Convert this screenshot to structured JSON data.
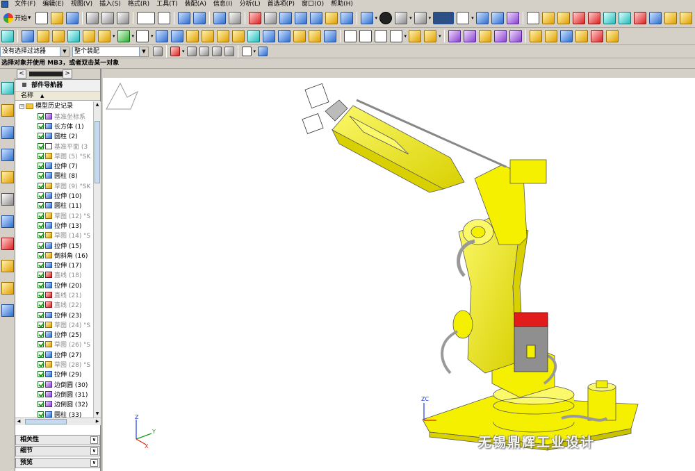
{
  "menu": [
    "文件(F)",
    "编辑(E)",
    "视图(V)",
    "插入(S)",
    "格式(R)",
    "工具(T)",
    "装配(A)",
    "信息(I)",
    "分析(L)",
    "首选项(P)",
    "窗口(O)",
    "帮助(H)"
  ],
  "toolbar": {
    "start_label": "开始"
  },
  "filters": {
    "selection_filter": "没有选择过滤器",
    "scope": "整个装配"
  },
  "cue_line": "选择对象并使用 MB3，或者双击某一对象",
  "navigator": {
    "title": "部件导航器",
    "column_name": "名称",
    "root": "模型历史记录",
    "items": [
      {
        "label": "基准坐标系",
        "type": "csys",
        "dim": true
      },
      {
        "label": "长方体 (1)",
        "type": "block",
        "dim": false
      },
      {
        "label": "圆柱 (2)",
        "type": "cyl",
        "dim": false
      },
      {
        "label": "基准平面 (3",
        "type": "plane",
        "dim": true
      },
      {
        "label": "草图 (5) \"SK",
        "type": "sketch",
        "dim": true
      },
      {
        "label": "拉伸 (7)",
        "type": "extrude",
        "dim": false
      },
      {
        "label": "圆柱 (8)",
        "type": "cyl",
        "dim": false
      },
      {
        "label": "草图 (9) \"SK",
        "type": "sketch",
        "dim": true
      },
      {
        "label": "拉伸 (10)",
        "type": "extrude",
        "dim": false
      },
      {
        "label": "圆柱 (11)",
        "type": "cyl",
        "dim": false
      },
      {
        "label": "草图 (12) \"S",
        "type": "sketch",
        "dim": true
      },
      {
        "label": "拉伸 (13)",
        "type": "extrude",
        "dim": false
      },
      {
        "label": "草图 (14) \"S",
        "type": "sketch",
        "dim": true
      },
      {
        "label": "拉伸 (15)",
        "type": "extrude",
        "dim": false
      },
      {
        "label": "倒斜角 (16)",
        "type": "chamfer",
        "dim": false
      },
      {
        "label": "拉伸 (17)",
        "type": "extrude",
        "dim": false
      },
      {
        "label": "直线 (18)",
        "type": "line",
        "dim": true
      },
      {
        "label": "拉伸 (20)",
        "type": "extrude",
        "dim": false
      },
      {
        "label": "直线 (21)",
        "type": "line",
        "dim": true
      },
      {
        "label": "直线 (22)",
        "type": "line",
        "dim": true
      },
      {
        "label": "拉伸 (23)",
        "type": "extrude",
        "dim": false
      },
      {
        "label": "草图 (24) \"S",
        "type": "sketch",
        "dim": true
      },
      {
        "label": "拉伸 (25)",
        "type": "extrude",
        "dim": false
      },
      {
        "label": "草图 (26) \"S",
        "type": "sketch",
        "dim": true
      },
      {
        "label": "拉伸 (27)",
        "type": "extrude",
        "dim": false
      },
      {
        "label": "草图 (28) \"S",
        "type": "sketch",
        "dim": true
      },
      {
        "label": "拉伸 (29)",
        "type": "extrude",
        "dim": false
      },
      {
        "label": "边倒圆 (30)",
        "type": "blend",
        "dim": false
      },
      {
        "label": "边倒圆 (31)",
        "type": "blend",
        "dim": false
      },
      {
        "label": "边倒圆 (32)",
        "type": "blend",
        "dim": false
      },
      {
        "label": "圆柱 (33)",
        "type": "cyl",
        "dim": false
      }
    ],
    "panels": [
      "相关性",
      "细节",
      "预览"
    ]
  },
  "viewport": {
    "wcs_labels": {
      "z": "Z",
      "y": "Y",
      "x": "X",
      "zc": "ZC"
    },
    "watermark": "无锡鼎辉工业设计",
    "model_color": "#f5f000",
    "motor_cap_color": "#e21b1b"
  }
}
